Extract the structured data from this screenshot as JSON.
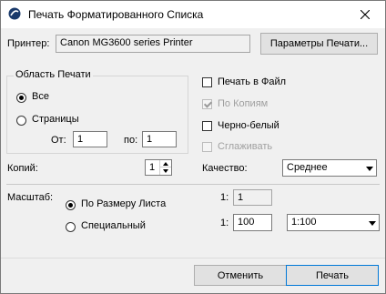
{
  "window": {
    "title": "Печать Форматированного Списка"
  },
  "printer": {
    "label": "Принтер:",
    "value": "Canon MG3600 series Printer",
    "settings_button": "Параметры Печати..."
  },
  "print_area": {
    "group_label": "Область Печати",
    "all_label": "Все",
    "pages_label": "Страницы",
    "from_label": "От:",
    "from_value": "1",
    "to_label": "по:",
    "to_value": "1",
    "selected": "all"
  },
  "options": {
    "print_to_file": "Печать в Файл",
    "by_copies": "По Копиям",
    "black_white": "Черно-белый",
    "smoothing": "Сглаживать"
  },
  "copies": {
    "label": "Копий:",
    "value": "1"
  },
  "quality": {
    "label": "Качество:",
    "value": "Среднее"
  },
  "scale": {
    "label": "Масштаб:",
    "fit_label": "По Размеру Листа",
    "custom_label": "Специальный",
    "selected": "fit",
    "fit_ratio_prefix": "1:",
    "fit_ratio_value": "1",
    "custom_ratio_prefix": "1:",
    "custom_ratio_value": "100",
    "custom_preset": "1:100"
  },
  "buttons": {
    "cancel": "Отменить",
    "print": "Печать"
  }
}
